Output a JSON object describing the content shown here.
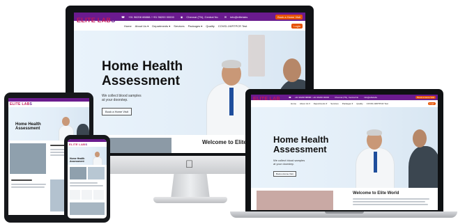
{
  "brand": {
    "logo_main": "ELITE LAB",
    "logo_o": "S",
    "accent_purple": "#6a1b8e",
    "accent_orange": "#e65100",
    "logo_pink": "#c2185b"
  },
  "topbar": {
    "phone": "+91 96208 88888 / +91 96200 00000",
    "location": "Chennai (TN), Central No",
    "email": "info@elitelabs",
    "cta": "Book a Home Visit"
  },
  "nav": {
    "items": [
      "Home",
      "About Us ▾",
      "Departments ▾",
      "Services",
      "Packages ▾",
      "Quality",
      "COVID-19/RTPCR Test"
    ],
    "login": "Login"
  },
  "hero": {
    "title_line1": "Home Health",
    "title_line2": "Assessment",
    "subtitle_line1": "We collect blood samples",
    "subtitle_line2": "at your doorstep.",
    "button": "Book a Home Visit"
  },
  "welcome": {
    "heading": "Welcome to Elite World",
    "heading_cut": "Welcome to Elite"
  },
  "icons": {
    "apple": "apple-logo-icon",
    "phone": "phone-icon",
    "location": "location-icon",
    "mail": "mail-icon"
  }
}
